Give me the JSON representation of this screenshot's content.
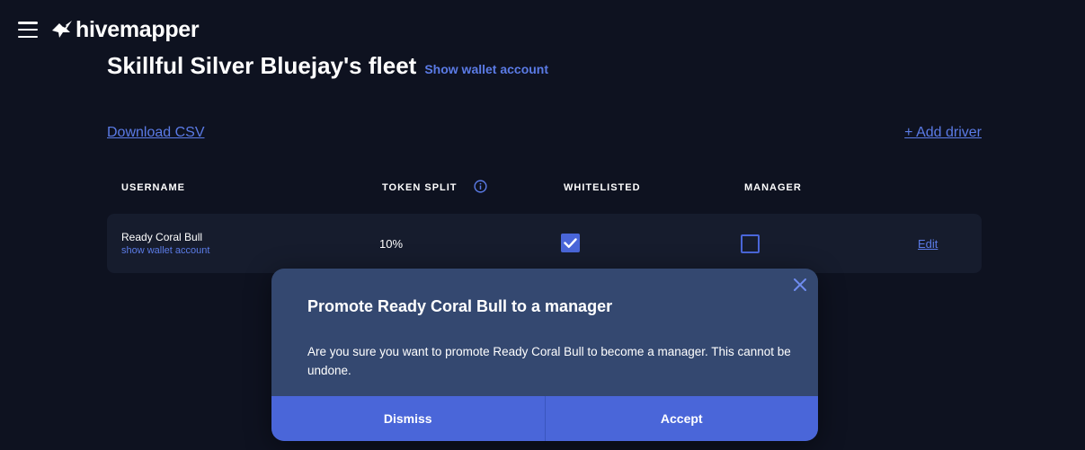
{
  "app": {
    "brand": "hivemapper"
  },
  "header": {
    "title": "Skillful Silver Bluejay's fleet",
    "wallet_link": "Show wallet account"
  },
  "actions": {
    "download_csv": "Download CSV",
    "add_driver": "+ Add driver"
  },
  "table": {
    "columns": [
      "USERNAME",
      "TOKEN SPLIT",
      "WHITELISTED",
      "MANAGER"
    ],
    "rows": [
      {
        "username": "Ready Coral Bull",
        "wallet_link": "show wallet account",
        "token_split": "10%",
        "whitelisted": true,
        "manager": false,
        "edit": "Edit"
      }
    ]
  },
  "modal": {
    "title": "Promote Ready Coral Bull to a manager",
    "body": "Are you sure you want to promote Ready Coral Bull to become a manager. This cannot be undone.",
    "dismiss_label": "Dismiss",
    "accept_label": "Accept"
  },
  "icons": {
    "menu": "hamburger-menu-icon",
    "logo": "hivemapper-bee-icon",
    "info": "info-circle-icon",
    "check": "checkmark-icon",
    "close": "close-icon"
  },
  "colors": {
    "background": "#0e1220",
    "row_background": "#161c2d",
    "accent": "#4a66d9",
    "link": "#5b7be6",
    "modal_background": "#344870"
  }
}
